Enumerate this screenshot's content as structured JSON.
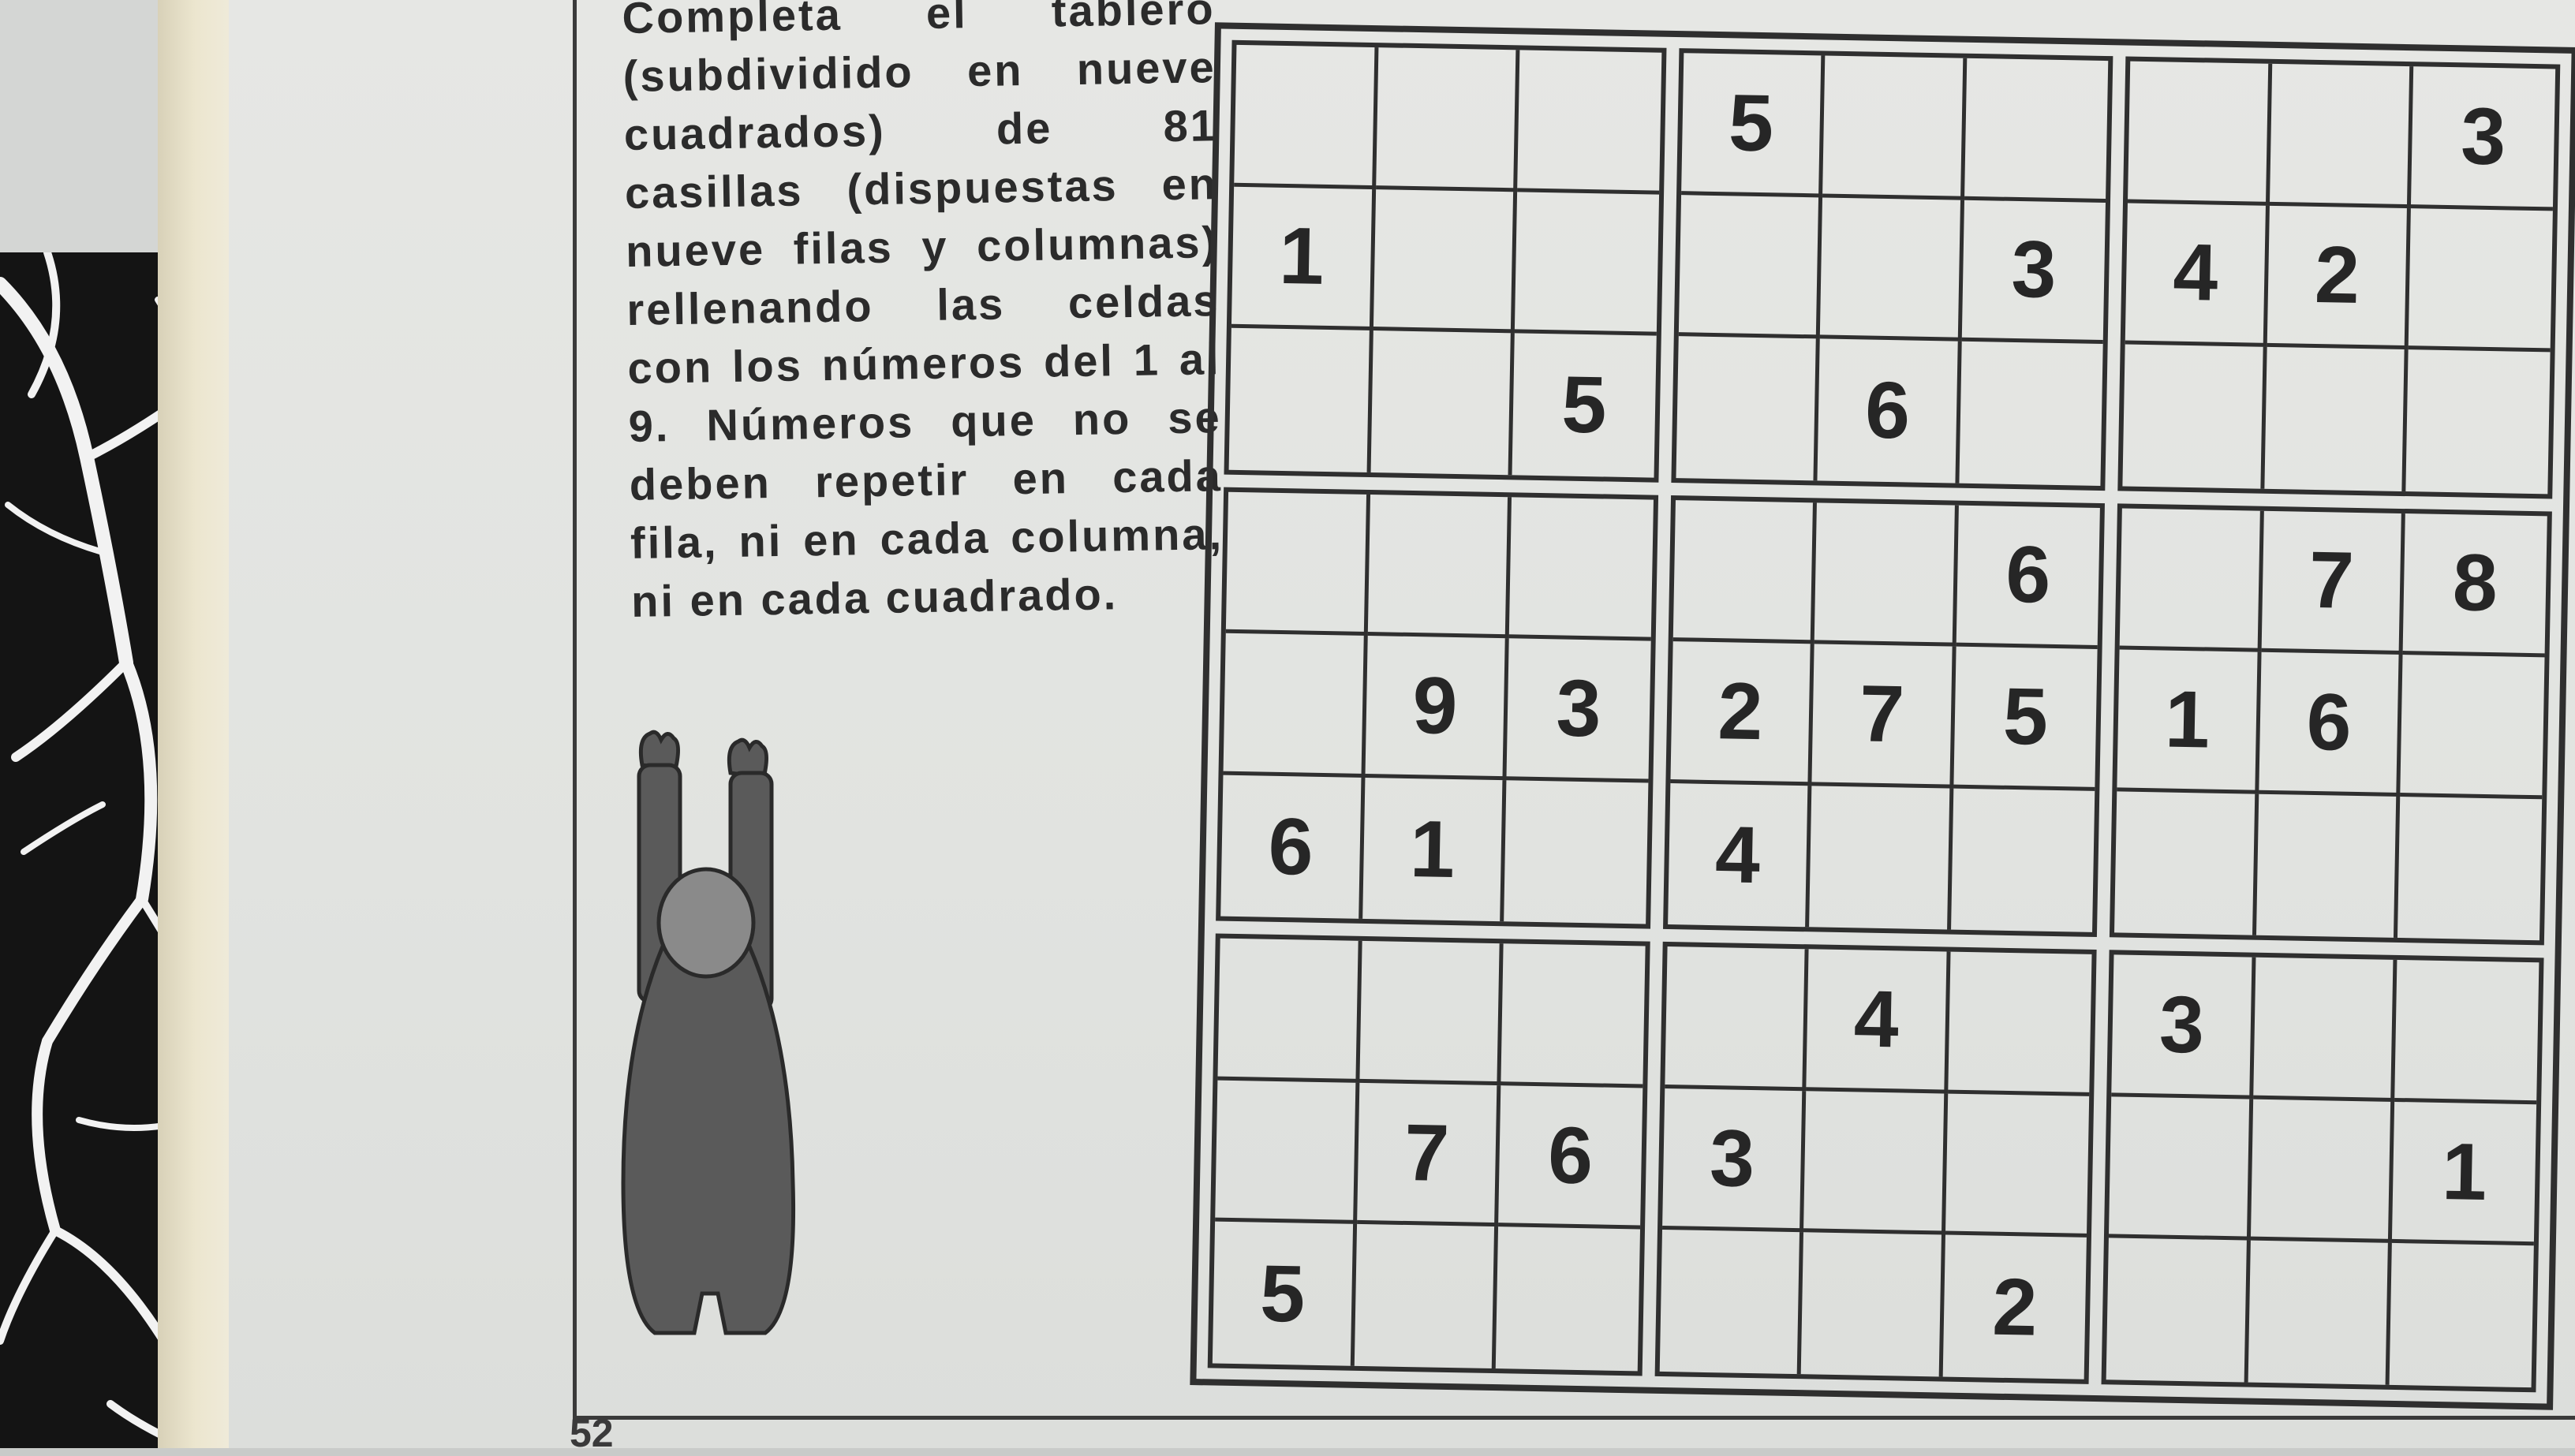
{
  "instructions": "Completa el tablero (subdividido en nueve cuadrados) de 81 casillas (dispuestas en nueve filas y columnas) rellenando las celdas con los números del 1 al 9. Números que no se deben repetir en cada fila, ni en cada columna, ni en cada cuadrado.",
  "page_number": "52",
  "sudoku": {
    "rows": [
      [
        "",
        "",
        "",
        "5",
        "",
        "",
        "",
        "",
        "3"
      ],
      [
        "1",
        "",
        "",
        "",
        "",
        "3",
        "4",
        "2",
        ""
      ],
      [
        "",
        "",
        "5",
        "",
        "6",
        "",
        "",
        "",
        ""
      ],
      [
        "",
        "",
        "",
        "",
        "",
        "6",
        "",
        "7",
        "8"
      ],
      [
        "",
        "9",
        "3",
        "2",
        "7",
        "5",
        "1",
        "6",
        ""
      ],
      [
        "6",
        "1",
        "",
        "4",
        "",
        "",
        "",
        "",
        ""
      ],
      [
        "",
        "",
        "",
        "",
        "4",
        "",
        "3",
        "",
        ""
      ],
      [
        "",
        "7",
        "6",
        "3",
        "",
        "",
        "",
        "",
        "1"
      ],
      [
        "5",
        "",
        "",
        "",
        "",
        "2",
        "",
        "",
        ""
      ]
    ]
  },
  "colors": {
    "ink": "#2f2f2f",
    "page": "#e2e4e1",
    "figure": "#5a5a5a"
  },
  "icons": {
    "figure": "person-arms-raised-illustration"
  }
}
